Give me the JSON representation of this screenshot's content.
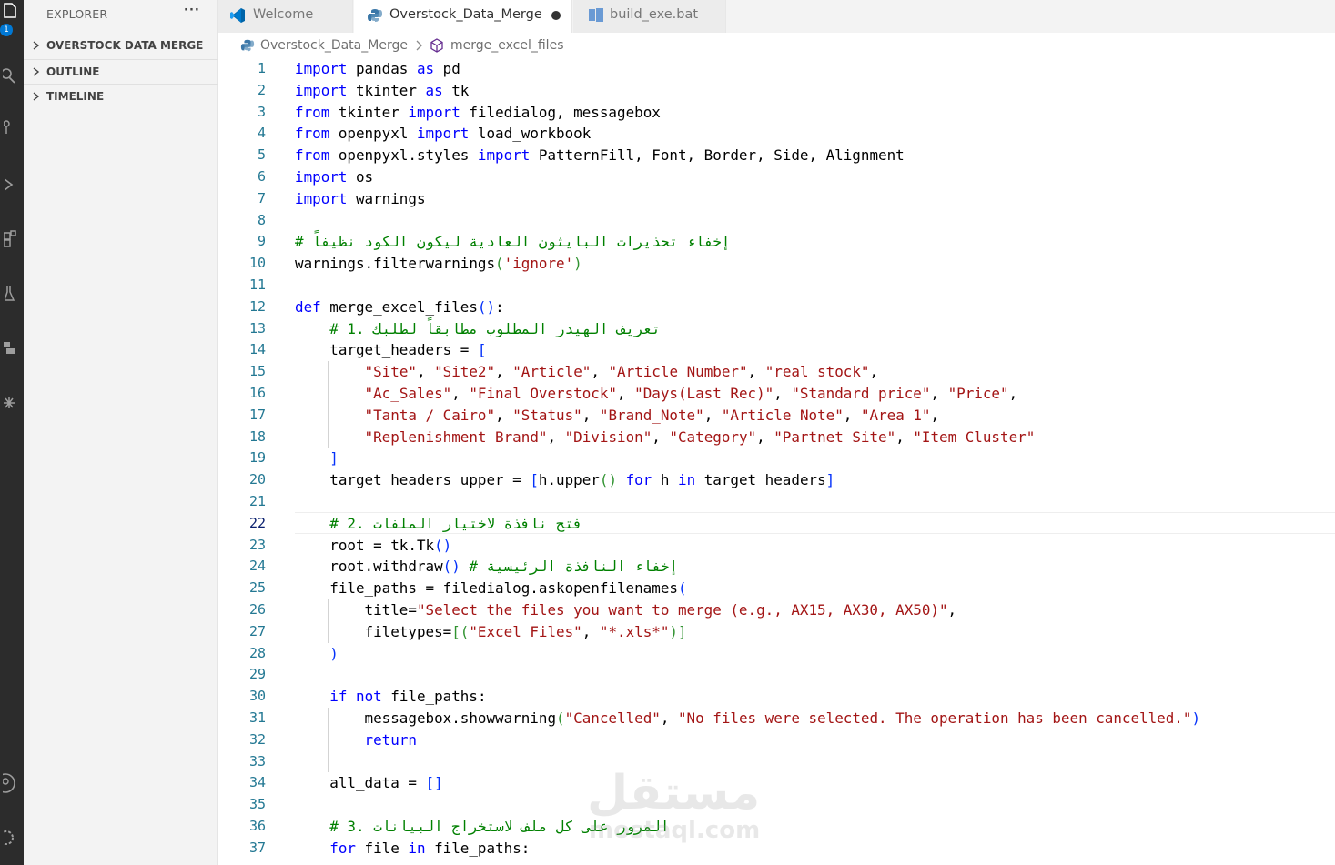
{
  "activity_bar": {
    "badge": "1",
    "icons": [
      "files-icon",
      "search-icon",
      "source-control-icon",
      "run-debug-icon",
      "extensions-icon",
      "testing-icon",
      "python-icon",
      "settings-sync-icon",
      "account-icon",
      "manage-gear-icon"
    ]
  },
  "sidebar": {
    "title": "EXPLORER",
    "more": "···",
    "sections": [
      {
        "label": "OVERSTOCK DATA MERGE"
      },
      {
        "label": "OUTLINE"
      },
      {
        "label": "TIMELINE"
      }
    ]
  },
  "tabs": [
    {
      "label": "Welcome",
      "icon": "vscode-icon",
      "active": false
    },
    {
      "label": "Overstock_Data_Merge",
      "icon": "python-file-icon",
      "active": true,
      "dirty": true
    },
    {
      "label": "build_exe.bat",
      "icon": "batch-file-icon",
      "active": false
    }
  ],
  "breadcrumb": {
    "file": "Overstock_Data_Merge",
    "symbol": "merge_excel_files"
  },
  "editor": {
    "current_line": 22,
    "lines": [
      [
        {
          "t": "import",
          "c": "kw"
        },
        {
          "t": " pandas "
        },
        {
          "t": "as",
          "c": "kw"
        },
        {
          "t": " pd"
        }
      ],
      [
        {
          "t": "import",
          "c": "kw"
        },
        {
          "t": " tkinter "
        },
        {
          "t": "as",
          "c": "kw"
        },
        {
          "t": " tk"
        }
      ],
      [
        {
          "t": "from",
          "c": "kw"
        },
        {
          "t": " tkinter "
        },
        {
          "t": "import",
          "c": "kw"
        },
        {
          "t": " filedialog, messagebox"
        }
      ],
      [
        {
          "t": "from",
          "c": "kw"
        },
        {
          "t": " openpyxl "
        },
        {
          "t": "import",
          "c": "kw"
        },
        {
          "t": " load_workbook"
        }
      ],
      [
        {
          "t": "from",
          "c": "kw"
        },
        {
          "t": " openpyxl.styles "
        },
        {
          "t": "import",
          "c": "kw"
        },
        {
          "t": " PatternFill, Font, Border, Side, Alignment"
        }
      ],
      [
        {
          "t": "import",
          "c": "kw"
        },
        {
          "t": " os"
        }
      ],
      [
        {
          "t": "import",
          "c": "kw"
        },
        {
          "t": " warnings"
        }
      ],
      [],
      [
        {
          "t": "# إخفاء تحذيرات البايثون العادية ليكون الكود نظيفاً",
          "c": "cm"
        }
      ],
      [
        {
          "t": "warnings.filterwarnings"
        },
        {
          "t": "(",
          "c": "pp"
        },
        {
          "t": "'ignore'",
          "c": "st"
        },
        {
          "t": ")",
          "c": "pp"
        }
      ],
      [],
      [
        {
          "t": "def",
          "c": "kw"
        },
        {
          "t": " merge_excel_files"
        },
        {
          "t": "()",
          "c": "pb"
        },
        {
          "t": ":"
        }
      ],
      [
        {
          "t": "    "
        },
        {
          "t": "# 1. تعريف الهيدر المطلوب مطابقاً لطلبك",
          "c": "cm"
        }
      ],
      [
        {
          "t": "    target_headers = "
        },
        {
          "t": "[",
          "c": "pb"
        }
      ],
      [
        {
          "t": "        "
        },
        {
          "t": "\"Site\"",
          "c": "st"
        },
        {
          "t": ", "
        },
        {
          "t": "\"Site2\"",
          "c": "st"
        },
        {
          "t": ", "
        },
        {
          "t": "\"Article\"",
          "c": "st"
        },
        {
          "t": ", "
        },
        {
          "t": "\"Article Number\"",
          "c": "st"
        },
        {
          "t": ", "
        },
        {
          "t": "\"real stock\"",
          "c": "st"
        },
        {
          "t": ","
        }
      ],
      [
        {
          "t": "        "
        },
        {
          "t": "\"Ac_Sales\"",
          "c": "st"
        },
        {
          "t": ", "
        },
        {
          "t": "\"Final Overstock\"",
          "c": "st"
        },
        {
          "t": ", "
        },
        {
          "t": "\"Days(Last Rec)\"",
          "c": "st"
        },
        {
          "t": ", "
        },
        {
          "t": "\"Standard price\"",
          "c": "st"
        },
        {
          "t": ", "
        },
        {
          "t": "\"Price\"",
          "c": "st"
        },
        {
          "t": ","
        }
      ],
      [
        {
          "t": "        "
        },
        {
          "t": "\"Tanta / Cairo\"",
          "c": "st"
        },
        {
          "t": ", "
        },
        {
          "t": "\"Status\"",
          "c": "st"
        },
        {
          "t": ", "
        },
        {
          "t": "\"Brand_Note\"",
          "c": "st"
        },
        {
          "t": ", "
        },
        {
          "t": "\"Article Note\"",
          "c": "st"
        },
        {
          "t": ", "
        },
        {
          "t": "\"Area 1\"",
          "c": "st"
        },
        {
          "t": ","
        }
      ],
      [
        {
          "t": "        "
        },
        {
          "t": "\"Replenishment Brand\"",
          "c": "st"
        },
        {
          "t": ", "
        },
        {
          "t": "\"Division\"",
          "c": "st"
        },
        {
          "t": ", "
        },
        {
          "t": "\"Category\"",
          "c": "st"
        },
        {
          "t": ", "
        },
        {
          "t": "\"Partnet Site\"",
          "c": "st"
        },
        {
          "t": ", "
        },
        {
          "t": "\"Item Cluster\"",
          "c": "st"
        }
      ],
      [
        {
          "t": "    "
        },
        {
          "t": "]",
          "c": "pb"
        }
      ],
      [
        {
          "t": "    target_headers_upper = "
        },
        {
          "t": "[",
          "c": "pb"
        },
        {
          "t": "h.upper"
        },
        {
          "t": "()",
          "c": "pp"
        },
        {
          "t": " "
        },
        {
          "t": "for",
          "c": "kw"
        },
        {
          "t": " h "
        },
        {
          "t": "in",
          "c": "kw"
        },
        {
          "t": " target_headers"
        },
        {
          "t": "]",
          "c": "pb"
        }
      ],
      [],
      [
        {
          "t": "    "
        },
        {
          "t": "# 2. فتح نافذة لاختيار الملفات",
          "c": "cm"
        }
      ],
      [
        {
          "t": "    root = tk.Tk"
        },
        {
          "t": "()",
          "c": "pb"
        }
      ],
      [
        {
          "t": "    root.withdraw"
        },
        {
          "t": "()",
          "c": "pb"
        },
        {
          "t": " "
        },
        {
          "t": "# إخفاء النافذة الرئيسية",
          "c": "cm"
        }
      ],
      [
        {
          "t": "    file_paths = filedialog.askopenfilenames"
        },
        {
          "t": "(",
          "c": "pb"
        }
      ],
      [
        {
          "t": "        title="
        },
        {
          "t": "\"Select the files you want to merge (e.g., AX15, AX30, AX50)\"",
          "c": "st"
        },
        {
          "t": ","
        }
      ],
      [
        {
          "t": "        filetypes="
        },
        {
          "t": "[(",
          "c": "pp"
        },
        {
          "t": "\"Excel Files\"",
          "c": "st"
        },
        {
          "t": ", "
        },
        {
          "t": "\"*.xls*\"",
          "c": "st"
        },
        {
          "t": ")]",
          "c": "pp"
        }
      ],
      [
        {
          "t": "    "
        },
        {
          "t": ")",
          "c": "pb"
        }
      ],
      [],
      [
        {
          "t": "    "
        },
        {
          "t": "if",
          "c": "kw"
        },
        {
          "t": " "
        },
        {
          "t": "not",
          "c": "kw"
        },
        {
          "t": " file_paths:"
        }
      ],
      [
        {
          "t": "        messagebox.showwarning"
        },
        {
          "t": "(",
          "c": "pp"
        },
        {
          "t": "\"Cancelled\"",
          "c": "st"
        },
        {
          "t": ", "
        },
        {
          "t": "\"No files were selected. The operation has been cancelled.\"",
          "c": "st"
        },
        {
          "t": ")",
          "c": "pb"
        }
      ],
      [
        {
          "t": "        "
        },
        {
          "t": "return",
          "c": "kw"
        }
      ],
      [],
      [
        {
          "t": "    all_data = "
        },
        {
          "t": "[]",
          "c": "pb"
        }
      ],
      [],
      [
        {
          "t": "    "
        },
        {
          "t": "# 3. المرور على كل ملف لاستخراج البيانات",
          "c": "cm"
        }
      ],
      [
        {
          "t": "    "
        },
        {
          "t": "for",
          "c": "kw"
        },
        {
          "t": " file "
        },
        {
          "t": "in",
          "c": "kw"
        },
        {
          "t": " file_paths:"
        }
      ]
    ]
  },
  "watermark": {
    "arabic": "مستقل",
    "latin": "mostaql.com"
  }
}
